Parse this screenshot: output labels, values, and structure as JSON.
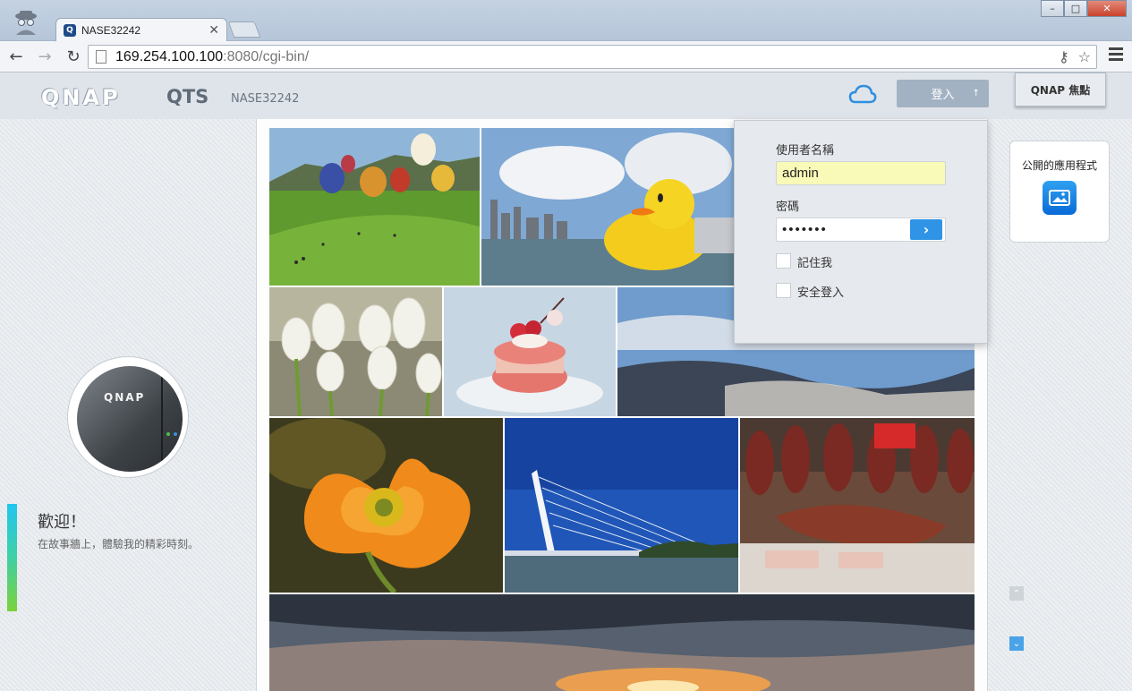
{
  "browser": {
    "tab_title": "NASE32242",
    "tab_favicon": "Q",
    "url_host": "169.254.100.100",
    "url_rest": ":8080/cgi-bin/"
  },
  "header": {
    "logo": "QNAP",
    "product": "QTS",
    "device_name": "NASE32242",
    "login_label": "登入",
    "login_arrow": "↑",
    "focus_label": "QNAP 焦點"
  },
  "login_panel": {
    "username_label": "使用者名稱",
    "username_value": "admin",
    "password_label": "密碼",
    "password_value": "•••••••",
    "submit_glyph": "›",
    "remember_label": "記住我",
    "secure_label": "安全登入"
  },
  "welcome": {
    "title": "歡迎！",
    "subtitle": "在故事牆上，體驗我的精彩時刻。",
    "nas_brand": "QNAP"
  },
  "right_panel": {
    "public_apps_label": "公開的應用程式",
    "scroll_up_glyph": "⌃",
    "scroll_down_glyph": "⌄"
  },
  "colors": {
    "accent": "#2f94e6",
    "login_button": "#a3b2c2",
    "username_fill": "#f9f9b8"
  },
  "photos": [
    {
      "name": "photo-balloons"
    },
    {
      "name": "photo-rubber-duck"
    },
    {
      "name": "photo-tulips"
    },
    {
      "name": "photo-macaron"
    },
    {
      "name": "photo-sky-clouds"
    },
    {
      "name": "photo-orange-poppy"
    },
    {
      "name": "photo-bridge"
    },
    {
      "name": "photo-ham-market"
    },
    {
      "name": "photo-sunset"
    }
  ]
}
